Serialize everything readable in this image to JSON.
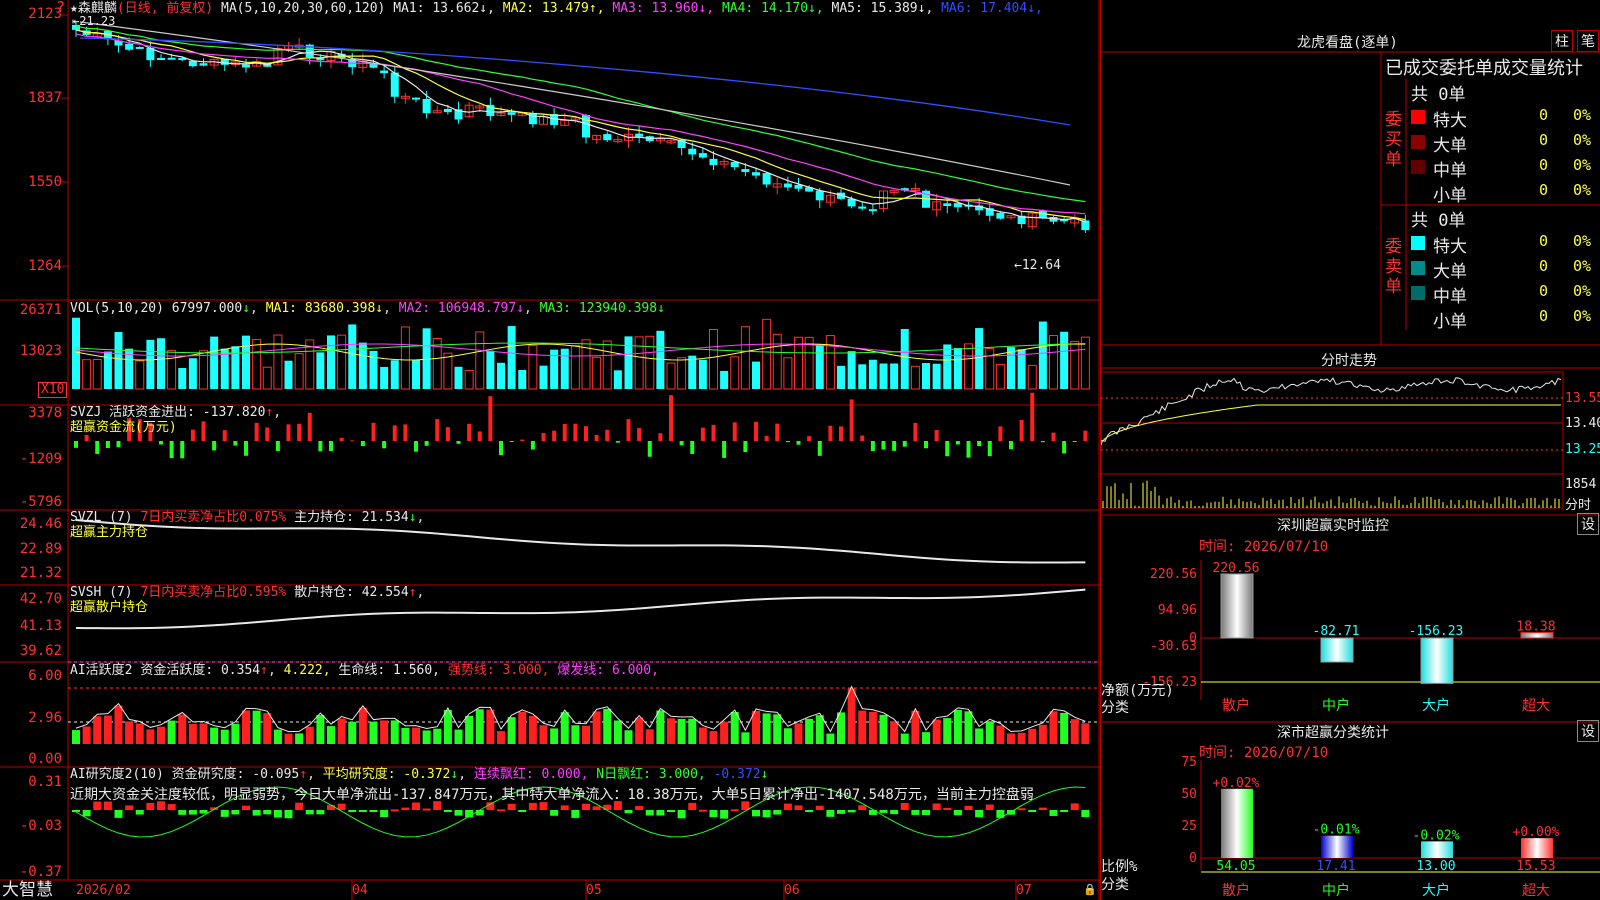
{
  "brand": "大智慧",
  "kline_panel": {
    "stock_name": "森麒麟",
    "period": "日线",
    "adjust": "前复权",
    "ma_label": "MA(5,10,20,30,60,120)",
    "ma": [
      {
        "name": "MA1",
        "value": "13.662",
        "arrow": "↓",
        "color": "#e8e8e8"
      },
      {
        "name": "MA2",
        "value": "13.479",
        "arrow": "↑",
        "color": "#ffff40"
      },
      {
        "name": "MA3",
        "value": "13.960",
        "arrow": "↓",
        "color": "#ff40ff"
      },
      {
        "name": "MA4",
        "value": "14.170",
        "arrow": "↓",
        "color": "#30ff30"
      },
      {
        "name": "MA5",
        "value": "15.389",
        "arrow": "↓",
        "color": "#e8e8e8"
      },
      {
        "name": "MA6",
        "value": "17.404",
        "arrow": "↓",
        "color": "#3050ff"
      }
    ],
    "high_marker": "21.23",
    "low_marker": "←12.64",
    "y_ticks": [
      "2123",
      "1837",
      "1550",
      "1264"
    ]
  },
  "vol_panel": {
    "label": "VOL(5,10,20)",
    "value": "67997.000",
    "ma1": "83680.398",
    "ma2": "106948.797",
    "ma3": "123940.398",
    "y_ticks": [
      "26371",
      "13023"
    ],
    "unit": "X10"
  },
  "svzj_panel": {
    "label": "SVZJ",
    "text": "活跃资金进出: -137.820",
    "subtitle": "超赢资金流(万元)",
    "y_ticks": [
      "3378",
      "-1209",
      "-5796"
    ]
  },
  "svzl_panel": {
    "label": "SVZL (7)",
    "ratio_text": "7日内买卖净占比0.075%",
    "hold_text": "主力持仓: 21.534",
    "subtitle": "超赢主力持仓",
    "y_ticks": [
      "24.46",
      "22.89",
      "21.32"
    ]
  },
  "svsh_panel": {
    "label": "SVSH (7)",
    "ratio_text": "7日内买卖净占比0.595%",
    "hold_text": "散户持仓: 42.554",
    "subtitle": "超赢散户持仓",
    "y_ticks": [
      "42.70",
      "41.13",
      "39.62"
    ]
  },
  "ai_active_panel": {
    "label": "AI活跃度2",
    "activity": "资金活跃度: 0.354",
    "v2": "4.222,",
    "life": "生命线: 1.560,",
    "strong": "强势线: 3.000,",
    "burst": "爆发线: 6.000,",
    "y_ticks": [
      "6.00",
      "2.96",
      "0.00"
    ]
  },
  "ai_research_panel": {
    "label": "AI研究度2(10)",
    "research": "资金研究度: -0.095",
    "avg": "平均研究度: -0.372",
    "red1": "连续飘红: 0.000,",
    "red2": "N日飘红: 3.000,",
    "last": "-0.372",
    "comment": "近期大资金关注度较低，明显弱势，今日大单净流出-137.847万元，其中特大单净流入：18.38万元，大单5日累计净出-1407.548万元，当前主力控盘弱",
    "y_ticks": [
      "0.31",
      "-0.03",
      "-0.37"
    ]
  },
  "x_axis": [
    "2026/02",
    "04",
    "05",
    "06",
    "07"
  ],
  "lhb": {
    "title": "龙虎看盘(逐单)",
    "btn1": "柱",
    "btn2": "笔",
    "subtitle": "已成交委托单成交量统计",
    "buy_side": "委买单",
    "sell_side": "委卖单",
    "buy_total": "共 0单",
    "sell_total": "共 0单",
    "buy_rows": [
      {
        "name": "特大",
        "qty": "0",
        "pct": "0%",
        "color": "#ff0000"
      },
      {
        "name": "大单",
        "qty": "0",
        "pct": "0%",
        "color": "#8b0000"
      },
      {
        "name": "中单",
        "qty": "0",
        "pct": "0%",
        "color": "#600000"
      },
      {
        "name": "小单",
        "qty": "0",
        "pct": "0%",
        "color": "#000000"
      }
    ],
    "sell_rows": [
      {
        "name": "特大",
        "qty": "0",
        "pct": "0%",
        "color": "#00ffff"
      },
      {
        "name": "大单",
        "qty": "0",
        "pct": "0%",
        "color": "#008b8b"
      },
      {
        "name": "中单",
        "qty": "0",
        "pct": "0%",
        "color": "#006b6b"
      },
      {
        "name": "小单",
        "qty": "0",
        "pct": "0%",
        "color": "#000000"
      }
    ]
  },
  "intraday": {
    "title": "分时走势",
    "prices": [
      "13.55",
      "13.40",
      "13.25"
    ],
    "vol_tick": "1854",
    "vol_label": "分时"
  },
  "sz_monitor": {
    "title": "深圳超赢实时监控",
    "btn": "设",
    "time": "时间: 2026/07/10",
    "y_ticks": [
      "220.56",
      "94.96",
      "0",
      "-30.63",
      "-156.23"
    ],
    "axis_label": "净额(万元)",
    "cat_label": "分类",
    "bars": [
      {
        "name": "散户",
        "value": 220.56,
        "label": "220.56"
      },
      {
        "name": "中户",
        "value": -82.71,
        "label": "-82.71"
      },
      {
        "name": "大户",
        "value": -156.23,
        "label": "-156.23"
      },
      {
        "name": "超大",
        "value": 18.38,
        "label": "18.38"
      }
    ]
  },
  "sz_class": {
    "title": "深市超赢分类统计",
    "btn": "设",
    "time": "时间: 2026/07/10",
    "y_ticks": [
      "75",
      "50",
      "25",
      "0"
    ],
    "axis_label": "比例%",
    "cat_label": "分类",
    "bars": [
      {
        "name": "散户",
        "value": 54.05,
        "label": "54.05",
        "delta": "+0.02%"
      },
      {
        "name": "中户",
        "value": 17.41,
        "label": "17.41",
        "delta": "-0.01%"
      },
      {
        "name": "大户",
        "value": 13.0,
        "label": "13.00",
        "delta": "-0.02%"
      },
      {
        "name": "超大",
        "value": 15.53,
        "label": "15.53",
        "delta": "+0.00%"
      }
    ]
  }
}
